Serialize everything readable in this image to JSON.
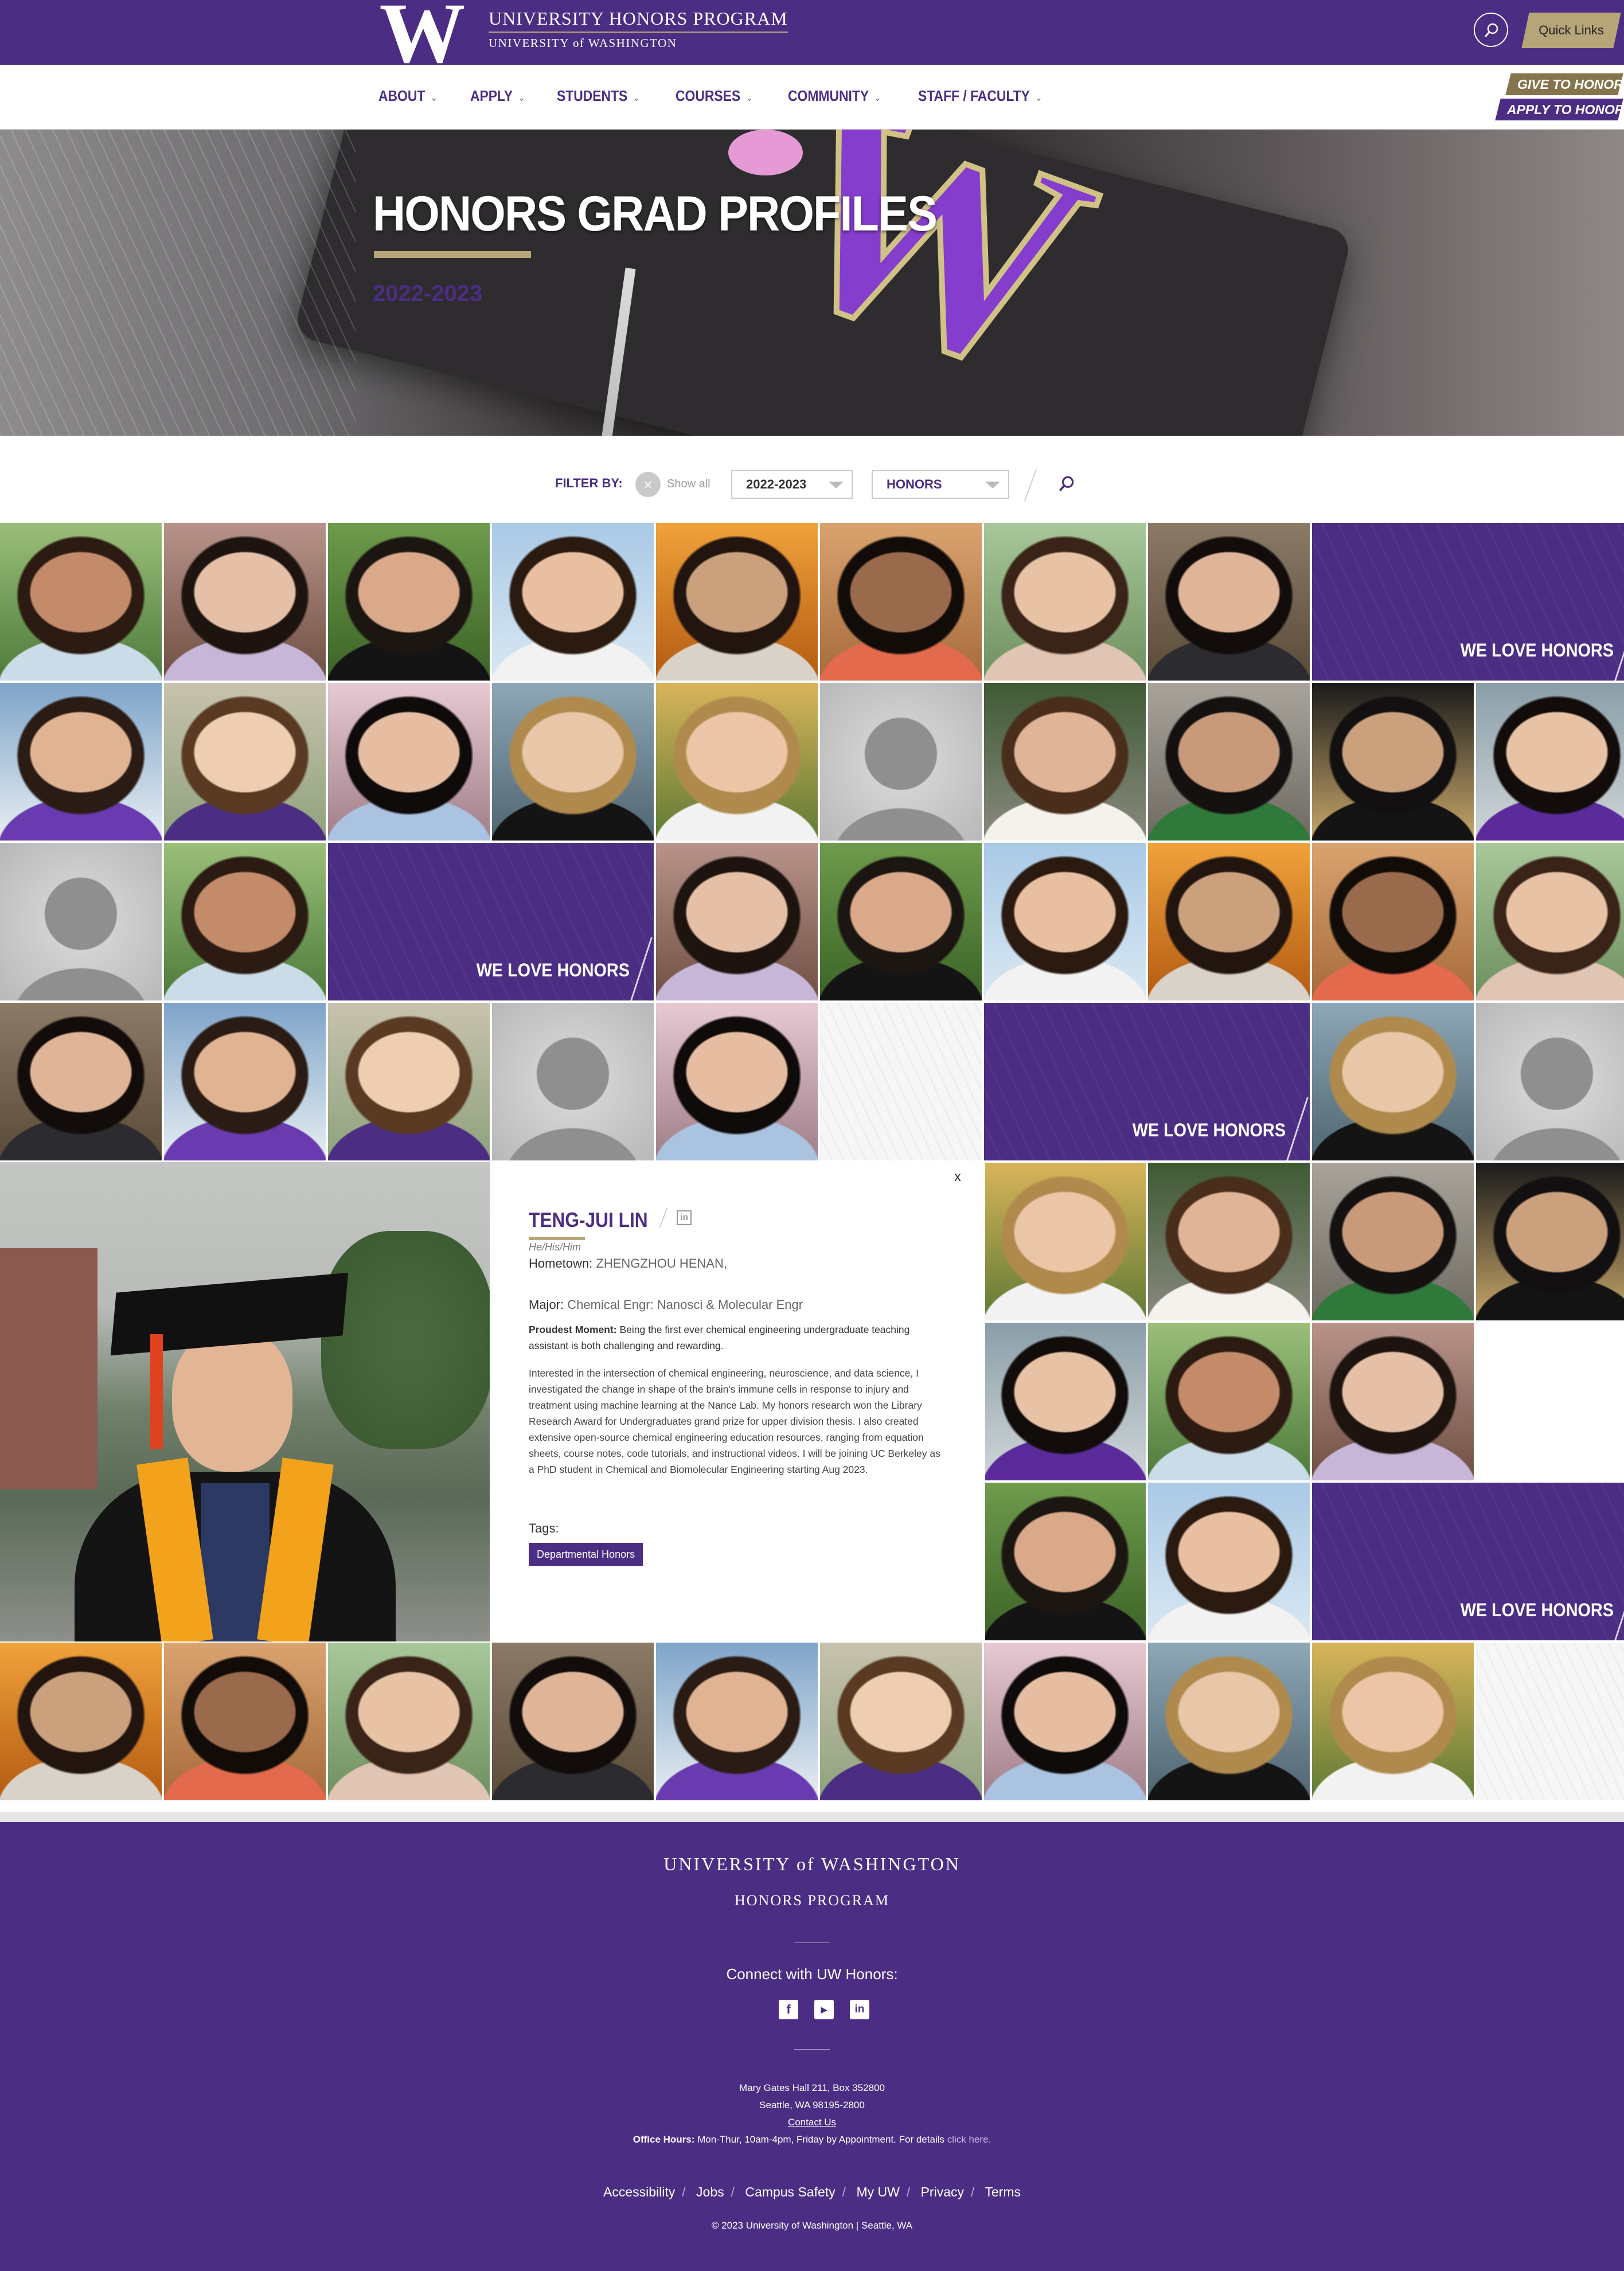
{
  "header": {
    "program_name": "UNIVERSITY HONORS PROGRAM",
    "university_name": "UNIVERSITY of WASHINGTON",
    "logo_letter": "W",
    "quick_links_label": "Quick Links"
  },
  "nav": {
    "items": [
      {
        "label": "ABOUT"
      },
      {
        "label": "APPLY"
      },
      {
        "label": "STUDENTS"
      },
      {
        "label": "COURSES"
      },
      {
        "label": "COMMUNITY"
      },
      {
        "label": "STAFF / FACULTY"
      }
    ],
    "give_label": "GIVE TO HONORS",
    "apply_label": "APPLY TO HONORS"
  },
  "hero": {
    "title": "HONORS GRAD PROFILES",
    "year": "2022-2023"
  },
  "filter": {
    "label": "FILTER BY:",
    "show_all": "Show all",
    "year_value": "2022-2023",
    "category_value": "HONORS",
    "clear_glyph": "×"
  },
  "grid": {
    "promo_label": "WE LOVE HONORS"
  },
  "detail": {
    "close_label": "x",
    "name": "TENG-JUI LIN",
    "linkedin_glyph": "in",
    "pronouns": "He/His/Him",
    "hometown_label": "Hometown:",
    "hometown": "ZHENGZHOU HENAN,",
    "major_label": "Major:",
    "major": "Chemical Engr: Nanosci & Molecular Engr",
    "proudest_label": "Proudest Moment:",
    "proudest": "Being the first ever chemical engineering undergraduate teaching assistant is both challenging and rewarding.",
    "bio": "Interested in the intersection of chemical engineering, neuroscience, and data science, I investigated the change in shape of the brain's immune cells in response to injury and treatment using machine learning at the Nance Lab. My honors research won the Library Research Award for Undergraduates grand prize for upper division thesis. I also created extensive open-source chemical engineering education resources, ranging from equation sheets, course notes, code tutorials, and instructional videos. I will be joining UC Berkeley as a PhD student in Chemical and Biomolecular Engineering starting Aug 2023.",
    "tags_label": "Tags:",
    "tag": "Departmental Honors"
  },
  "footer": {
    "university": "UNIVERSITY of WASHINGTON",
    "program": "HONORS PROGRAM",
    "connect": "Connect with UW Honors:",
    "address1": "Mary Gates Hall 211, Box 352800",
    "address2": "Seattle, WA 98195-2800",
    "contact": "Contact Us",
    "hours_label": "Office Hours:",
    "hours": "Mon-Thur, 10am-4pm, Friday by Appointment. For details",
    "hours_link": "click here.",
    "links": [
      "Accessibility",
      "Jobs",
      "Campus Safety",
      "My UW",
      "Privacy",
      "Terms"
    ],
    "copyright": "© 2023 University of Washington | Seattle, WA"
  },
  "colors": {
    "uw_purple": "#4b2e83",
    "uw_gold": "#b7a57a",
    "uw_dark_gold": "#85754d"
  }
}
